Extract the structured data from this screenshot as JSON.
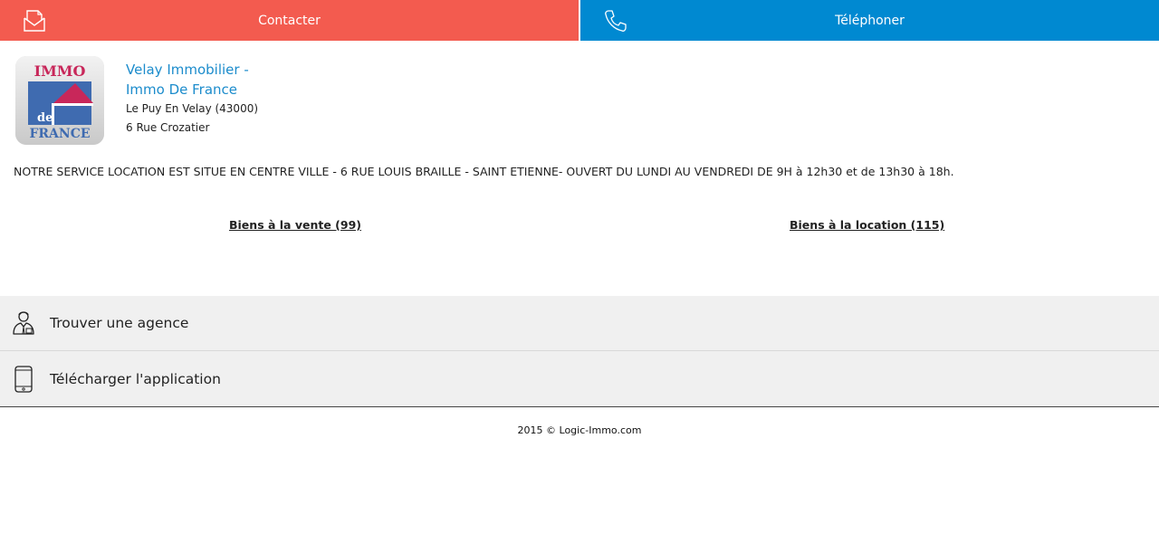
{
  "topbar": {
    "contact_label": "Contacter",
    "phone_label": "Téléphoner",
    "contact_color": "#f35b4f",
    "phone_color": "#0089d1"
  },
  "agency": {
    "name": "Velay Immobilier - Immo De France",
    "city": "Le Puy En Velay (43000)",
    "address": "6 Rue Crozatier",
    "logo_text": [
      "IMMO",
      "de",
      "FRANCE"
    ],
    "name_color": "#1c8ccc"
  },
  "description": "NOTRE SERVICE LOCATION EST SITUE EN CENTRE VILLE - 6 RUE LOUIS BRAILLE - SAINT ETIENNE- OUVERT DU LUNDI AU VENDREDI DE 9H à 12h30 et de 13h30 à 18h.",
  "links": {
    "sale": "Biens à la vente (99)",
    "rent": "Biens à la location (115)"
  },
  "menu": {
    "items": [
      {
        "label": "Trouver une agence",
        "icon": "agent-person-icon"
      },
      {
        "label": "Télécharger l'application",
        "icon": "smartphone-icon"
      }
    ]
  },
  "footer": {
    "text": "2015 © Logic-Immo.com"
  }
}
